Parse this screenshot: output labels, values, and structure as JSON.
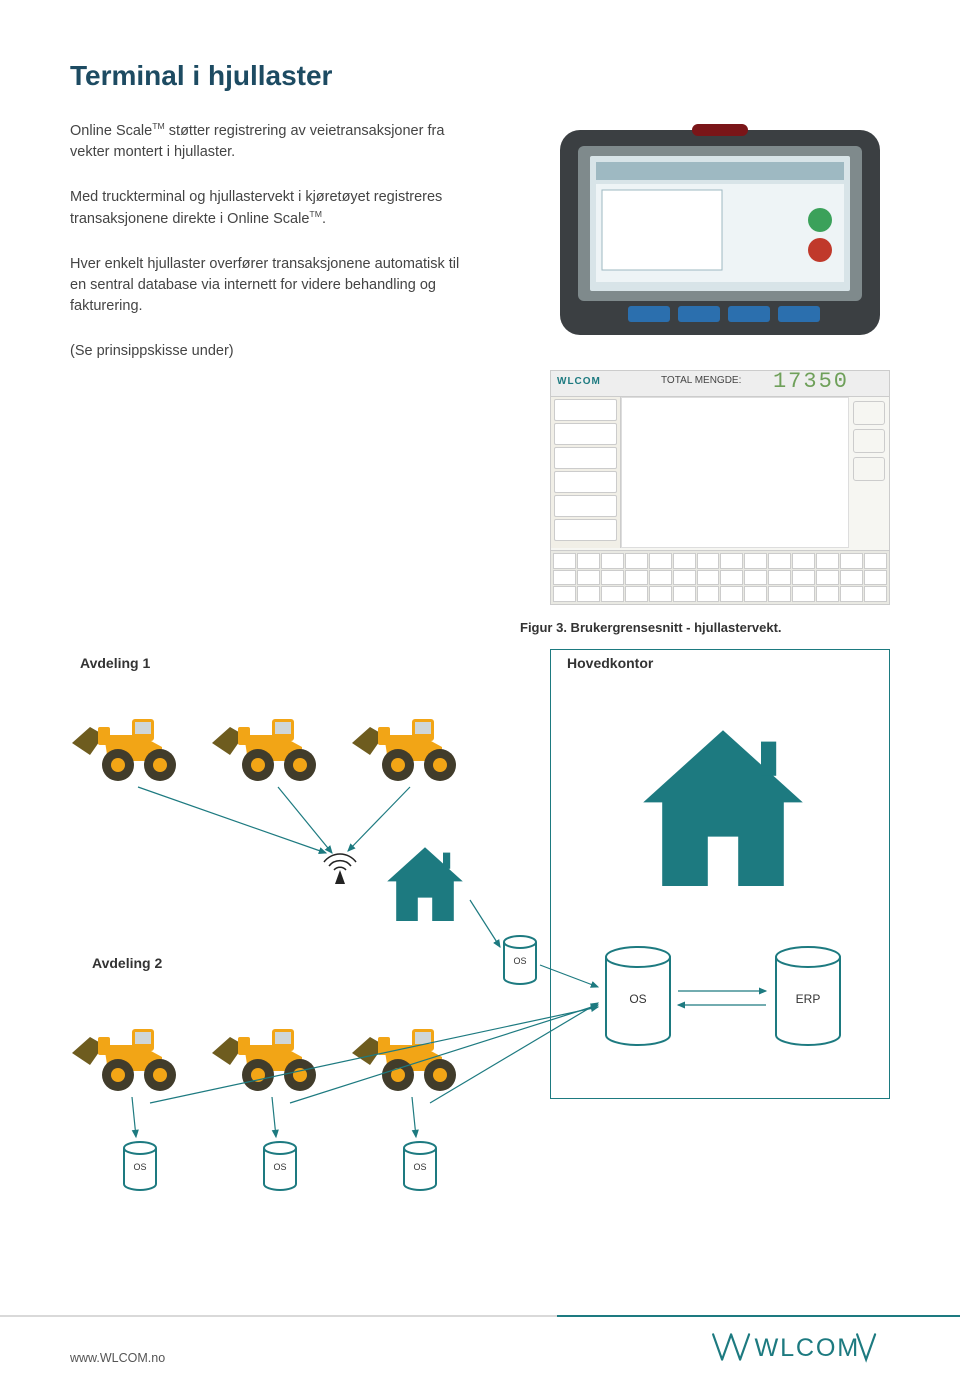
{
  "page_title": "Terminal i hjullaster",
  "paragraphs": {
    "p1_pre": "Online Scale",
    "p1_post": " støtter registrering av veietransaksjoner fra vekter montert i hjullaster.",
    "p2_pre": "Med truckterminal og hjullastervekt i kjøretøyet registreres transaksjonene direkte i Online Scale",
    "p2_post": ".",
    "p3": "Hver enkelt hjullaster overfører transaksjonene automatisk til en sentral database via internett for videre behandling og fakturering.",
    "p4": "(Se prinsippskisse under)"
  },
  "tm": "TM",
  "figure": {
    "caption": "Figur 3. Brukergrensesnitt - hjullastervekt.",
    "app_label_totalmengde": "TOTAL MENGDE:",
    "app_total_value": "17350",
    "app_logo_text": "WLCOM"
  },
  "diagram": {
    "avdeling1": "Avdeling 1",
    "avdeling2": "Avdeling 2",
    "hovedkontor": "Hovedkontor",
    "os_label": "OS",
    "erp_label": "ERP"
  },
  "footer": {
    "url": "www.WLCOM.no",
    "brand_text": "WLCOM"
  },
  "colors": {
    "heading": "#1d4b62",
    "teal": "#1d7a80",
    "loader_body": "#f2a516",
    "loader_tire": "#413c2b"
  }
}
